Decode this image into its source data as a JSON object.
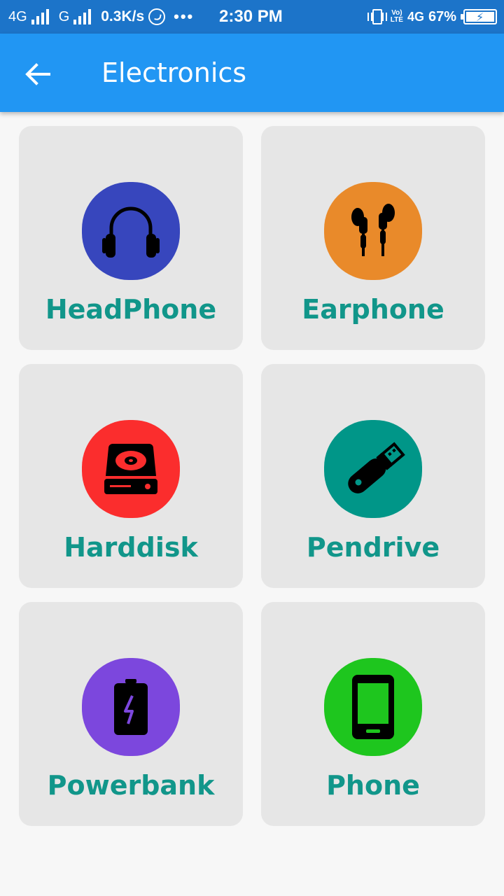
{
  "status_bar": {
    "net1": "4G",
    "net2": "G",
    "speed": "0.3K/s",
    "more": "•••",
    "time": "2:30 PM",
    "volte_top": "Vo)",
    "volte_bottom": "LTE",
    "net3": "4G",
    "battery_percent": "67%"
  },
  "app_bar": {
    "title": "Electronics",
    "color": "#2196f3"
  },
  "categories": [
    {
      "label": "HeadPhone",
      "icon": "headphone-icon",
      "color": "#3746bd"
    },
    {
      "label": "Earphone",
      "icon": "earphone-icon",
      "color": "#e98a2a"
    },
    {
      "label": "Harddisk",
      "icon": "harddisk-icon",
      "color": "#fb2d2d"
    },
    {
      "label": "Pendrive",
      "icon": "pendrive-icon",
      "color": "#009688"
    },
    {
      "label": "Powerbank",
      "icon": "powerbank-icon",
      "color": "#7c47dd"
    },
    {
      "label": "Phone",
      "icon": "phone-icon",
      "color": "#1ec61e"
    }
  ]
}
